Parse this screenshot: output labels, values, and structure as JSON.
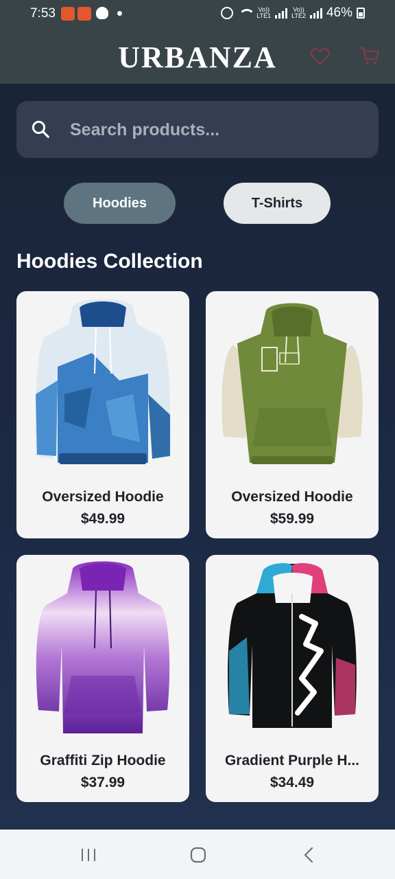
{
  "status_bar": {
    "time": "7:53",
    "network_1": "LTE1",
    "network_2": "LTE2",
    "vo_label": "Vo))",
    "battery": "46%"
  },
  "header": {
    "brand": "URBANZA",
    "icons": [
      "heart-icon",
      "cart-icon"
    ]
  },
  "search": {
    "placeholder": "Search products..."
  },
  "categories": [
    {
      "label": "Hoodies",
      "selected": true
    },
    {
      "label": "T-Shirts",
      "selected": false
    }
  ],
  "section_title": "Hoodies Collection",
  "products": [
    {
      "name": "Oversized Hoodie",
      "price": "$49.99"
    },
    {
      "name": "Oversized Hoodie",
      "price": "$59.99"
    },
    {
      "name": "Graffiti Zip Hoodie",
      "price": "$37.99"
    },
    {
      "name": "Gradient Purple H...",
      "price": "$34.49"
    }
  ],
  "colors": {
    "header_bg": "#394449",
    "page_bg": "#1c2a45",
    "search_bg": "#343d52",
    "tab_active": "#5e7481",
    "tab_inactive": "#e6e7e8",
    "card_bg": "#f4f4f5",
    "header_icon": "#7a3b48"
  }
}
